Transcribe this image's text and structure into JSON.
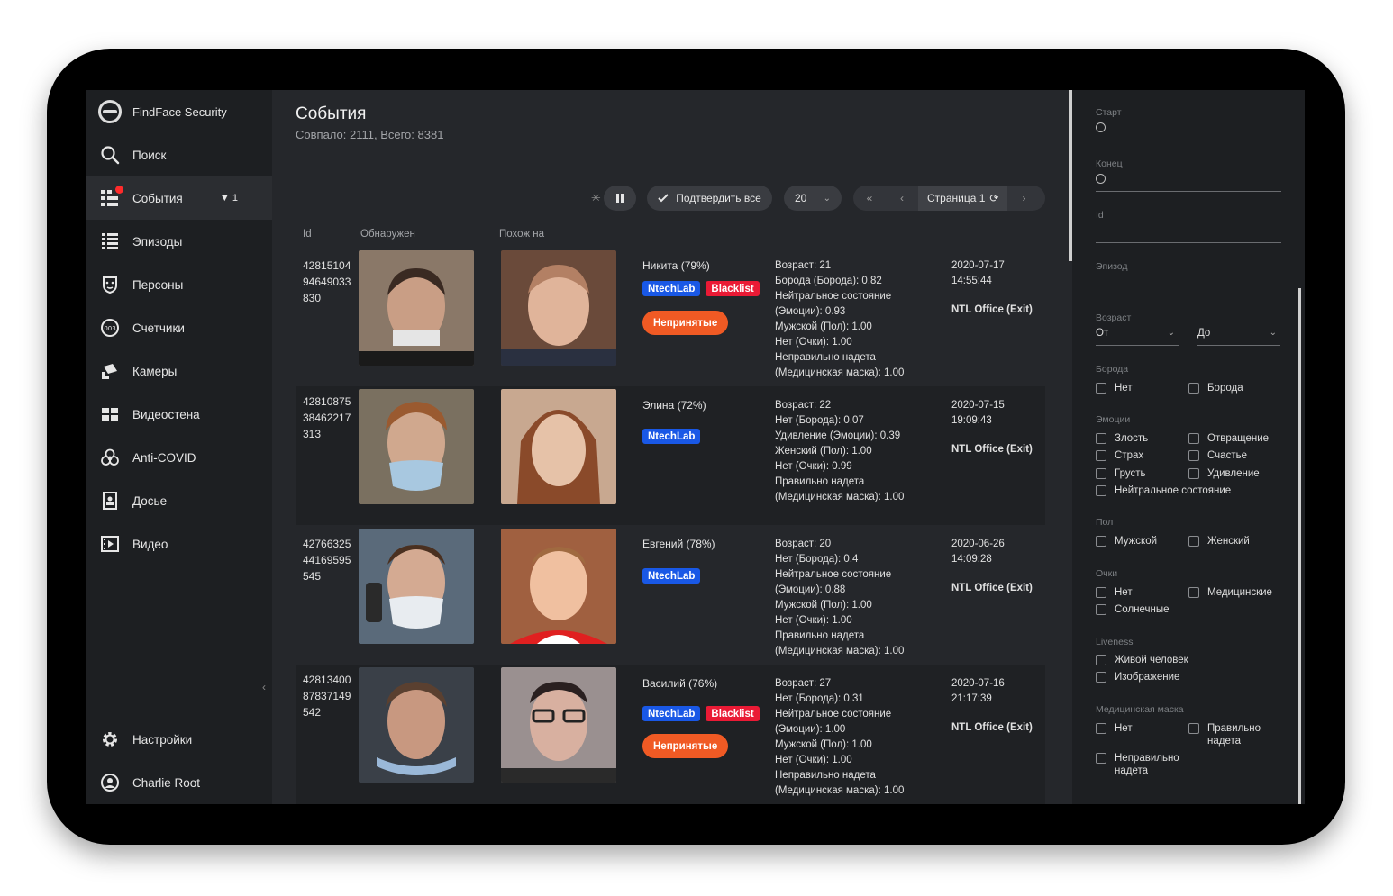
{
  "app": {
    "title": "FindFace Security"
  },
  "sidebar": {
    "items": [
      {
        "label": "Поиск",
        "icon": "search-icon"
      },
      {
        "label": "События",
        "icon": "events-icon",
        "filter_count": "1",
        "active": true
      },
      {
        "label": "Эпизоды",
        "icon": "episodes-icon"
      },
      {
        "label": "Персоны",
        "icon": "persons-icon"
      },
      {
        "label": "Счетчики",
        "icon": "counters-icon"
      },
      {
        "label": "Камеры",
        "icon": "camera-icon"
      },
      {
        "label": "Видеостена",
        "icon": "videowall-icon"
      },
      {
        "label": "Anti-COVID",
        "icon": "biohazard-icon"
      },
      {
        "label": "Досье",
        "icon": "dossier-icon"
      },
      {
        "label": "Видео",
        "icon": "video-icon"
      }
    ],
    "settings": "Настройки",
    "user": "Charlie Root"
  },
  "header": {
    "title": "События",
    "subtitle": "Совпало: 2111, Всего: 8381"
  },
  "toolbar": {
    "confirm_all": "Подтвердить все",
    "page_size": "20",
    "page_label": "Страница 1"
  },
  "table": {
    "columns": {
      "id": "Id",
      "detected": "Обнаружен",
      "similar": "Похож на"
    },
    "rows": [
      {
        "id": "4281510494649033830",
        "match": "Никита (79%)",
        "tags": [
          "NtechLab",
          "Blacklist"
        ],
        "reject": "Непринятые",
        "attrs": "Возраст: 21\nБорода (Борода): 0.82\nНейтральное состояние (Эмоции): 0.93\nМужской (Пол): 1.00\nНет (Очки): 1.00\nНеправильно надета (Медицинская маска): 1.00",
        "date": "2020-07-17",
        "time": "14:55:44",
        "camera": "NTL Office (Exit)"
      },
      {
        "id": "4281087538462217313",
        "match": "Элина (72%)",
        "tags": [
          "NtechLab"
        ],
        "reject": "",
        "attrs": "Возраст: 22\nНет (Борода): 0.07\nУдивление (Эмоции): 0.39\nЖенский (Пол): 1.00\nНет (Очки): 0.99\nПравильно надета (Медицинская маска): 1.00",
        "date": "2020-07-15",
        "time": "19:09:43",
        "camera": "NTL Office (Exit)"
      },
      {
        "id": "4276632544169595545",
        "match": "Евгений (78%)",
        "tags": [
          "NtechLab"
        ],
        "reject": "",
        "attrs": "Возраст: 20\nНет (Борода): 0.4\nНейтральное состояние (Эмоции): 0.88\nМужской (Пол): 1.00\nНет (Очки): 1.00\nПравильно надета (Медицинская маска): 1.00",
        "date": "2020-06-26",
        "time": "14:09:28",
        "camera": "NTL Office (Exit)"
      },
      {
        "id": "4281340087837149542",
        "match": "Василий (76%)",
        "tags": [
          "NtechLab",
          "Blacklist"
        ],
        "reject": "Непринятые",
        "attrs": "Возраст: 27\nНет (Борода): 0.31\nНейтральное состояние (Эмоции): 1.00\nМужской (Пол): 1.00\nНет (Очки): 1.00\nНеправильно надета (Медицинская маска): 1.00",
        "date": "2020-07-16",
        "time": "21:17:39",
        "camera": "NTL Office (Exit)"
      }
    ]
  },
  "filters": {
    "start": "Старт",
    "end": "Конец",
    "id": "Id",
    "episode": "Эпизод",
    "age": {
      "label": "Возраст",
      "from": "От",
      "to": "До"
    },
    "beard": {
      "label": "Борода",
      "options": [
        "Нет",
        "Борода"
      ]
    },
    "emotions": {
      "label": "Эмоции",
      "options": [
        "Злость",
        "Отвращение",
        "Страх",
        "Счастье",
        "Грусть",
        "Удивление",
        "Нейтральное состояние"
      ]
    },
    "gender": {
      "label": "Пол",
      "options": [
        "Мужской",
        "Женский"
      ]
    },
    "glasses": {
      "label": "Очки",
      "options": [
        "Нет",
        "Медицинские",
        "Солнечные"
      ]
    },
    "liveness": {
      "label": "Liveness",
      "options": [
        "Живой человек",
        "Изображение"
      ]
    },
    "mask": {
      "label": "Медицинская маска",
      "options": [
        "Нет",
        "Правильно надета",
        "Неправильно надета"
      ]
    }
  },
  "colors": {
    "accent_blue": "#1958e6",
    "blacklist_red": "#ea1a35",
    "reject_orange": "#f05a24",
    "sidebar_bg": "#1d1f22",
    "main_bg": "#25272b"
  }
}
